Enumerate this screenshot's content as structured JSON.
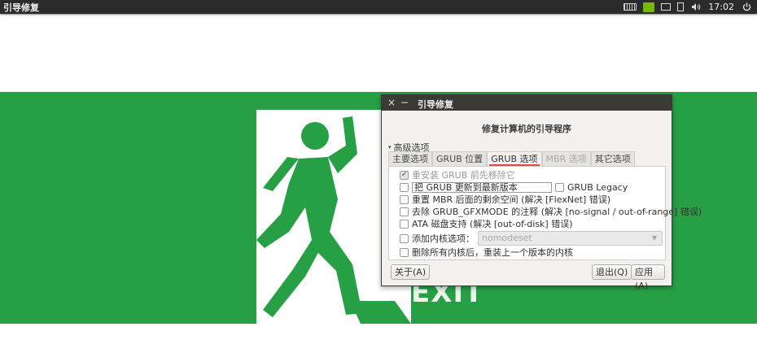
{
  "topbar": {
    "app_title": "引导修复",
    "time": "17:02",
    "icons": [
      "keyboard-icon",
      "nvidia-icon",
      "monitor-icon",
      "battery-icon",
      "volume-icon",
      "power-icon"
    ]
  },
  "background": {
    "exit_text": "EXIT",
    "green": "#27a045"
  },
  "dialog": {
    "title": "引导修复",
    "close_glyph": "×",
    "minimize_glyph": "−",
    "heading": "修复计算机的引导程序",
    "expander_label": "高级选项",
    "tabs": [
      {
        "label": "主要选项",
        "state": "normal"
      },
      {
        "label": "GRUB 位置",
        "state": "normal"
      },
      {
        "label": "GRUB 选项",
        "state": "active"
      },
      {
        "label": "MBR 选项",
        "state": "disabled"
      },
      {
        "label": "其它选项",
        "state": "normal"
      }
    ],
    "options": {
      "purge_grub": {
        "label": "重安装 GRUB 前先移除它",
        "checked": true,
        "disabled": true
      },
      "upgrade_grub": {
        "label": "把 GRUB 更新到最新版本",
        "checked": false
      },
      "grub_legacy": {
        "label": "GRUB Legacy",
        "checked": false
      },
      "reset_mbr": {
        "label": "重置 MBR 后面的剩余空间 (解决 [FlexNet] 错误)",
        "checked": false
      },
      "gfxmode": {
        "label": "去除 GRUB_GFXMODE 的注释 (解决 [no-signal / out-of-range] 错误)",
        "checked": false
      },
      "ata": {
        "label": "ATA 磁盘支持 (解决 [out-of-disk] 错误)",
        "checked": false
      },
      "kernel_option": {
        "label": "添加内核选项：",
        "checked": false,
        "value": "nomodeset"
      },
      "remove_kernels": {
        "label": "删除所有内核后，重装上一个版本的内核",
        "checked": false
      }
    },
    "buttons": {
      "about": "关于(A)",
      "quit": "退出(Q)",
      "apply": "应用(A)"
    }
  }
}
